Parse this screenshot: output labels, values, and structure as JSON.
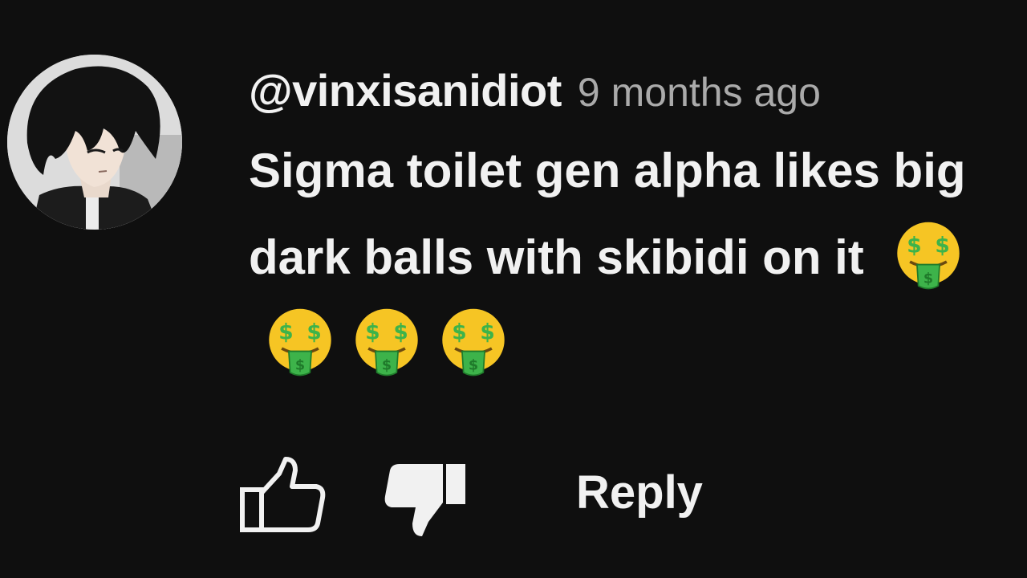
{
  "comment": {
    "author": "@vinxisanidiot",
    "timestamp": "9 months ago",
    "text": "Sigma toilet gen alpha likes big dark balls with skibidi on it",
    "emojis": [
      "🤑",
      "🤑",
      "🤑",
      "🤑"
    ],
    "avatar_icon": "anime-character-avatar"
  },
  "actions": {
    "like_icon": "thumbs-up-outline-icon",
    "dislike_icon": "thumbs-down-filled-icon",
    "reply_label": "Reply"
  },
  "colors": {
    "background": "#0f0f0f",
    "text_primary": "#f1f1f1",
    "text_secondary": "#aaaaaa",
    "emoji_face": "#f6c524",
    "emoji_money": "#3db34a"
  }
}
